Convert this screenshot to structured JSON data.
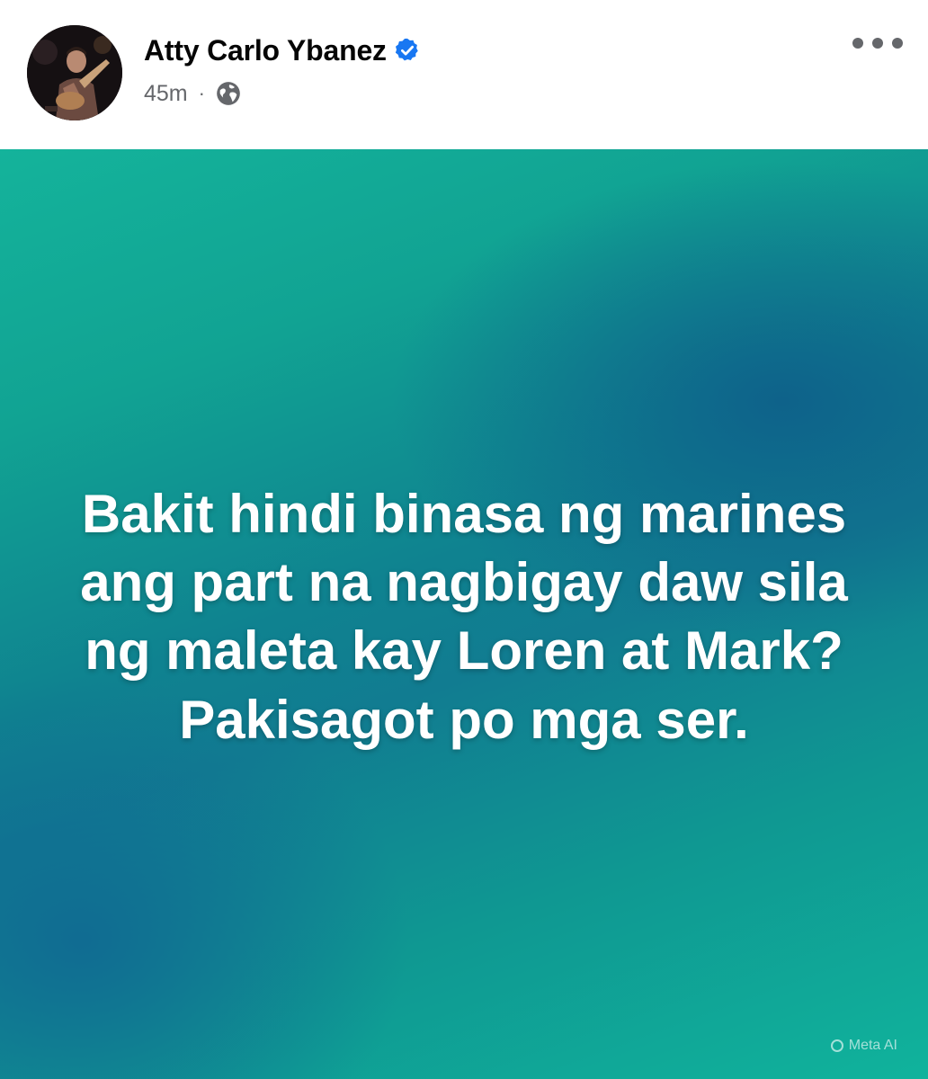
{
  "post": {
    "author": {
      "name": "Atty Carlo Ybanez",
      "verified": true,
      "avatar": "profile-photo-guitarist"
    },
    "timestamp": "45m",
    "separator": "·",
    "audience_icon": "globe-icon",
    "more_icon": "more-options-icon",
    "text_lines": [
      "Bakit hindi binasa ng marines",
      "ang part na nagbigay daw sila",
      "ng maleta kay Loren at Mark?",
      "Pakisagot po mga ser."
    ],
    "background_colors": [
      "#14b39b",
      "#0f7d92",
      "#10b39c"
    ],
    "watermark": "Meta AI"
  },
  "colors": {
    "verified_badge": "#1877f2",
    "secondary_text": "#65676b",
    "primary_text": "#050505"
  }
}
